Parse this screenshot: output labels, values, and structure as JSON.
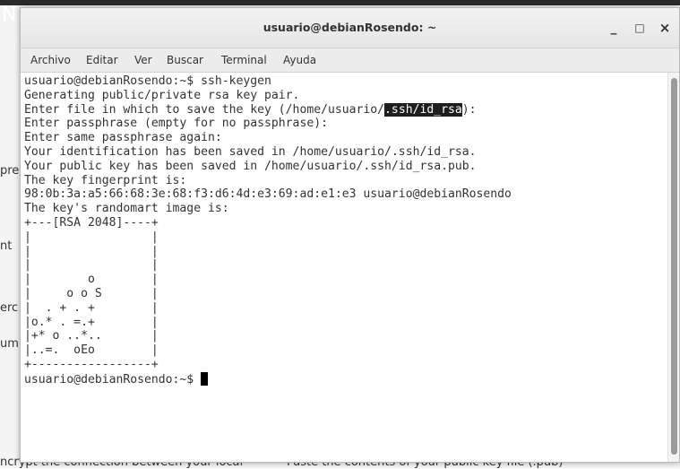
{
  "background": {
    "top_left_glyph": "N",
    "left_fragments": [
      "pre",
      "nt",
      "erc",
      "um"
    ],
    "bottom_left_text": "ncrypt the connection between your local",
    "bottom_right_text": "Paste the contents of your public key file (.pub)"
  },
  "window": {
    "title": "usuario@debianRosendo: ~",
    "minimize_glyph": "_",
    "maximize_glyph": "□",
    "close_glyph": "×"
  },
  "menu": {
    "items": [
      "Archivo",
      "Editar",
      "Ver",
      "Buscar",
      "Terminal",
      "Ayuda"
    ]
  },
  "terminal": {
    "line1": "usuario@debianRosendo:~$ ssh-keygen",
    "line2": "Generating public/private rsa key pair.",
    "line3_prefix": "Enter file in which to save the key (/home/usuario/",
    "line3_selected": ".ssh/id_rsa",
    "line3_suffix": "):",
    "line4": "Enter passphrase (empty for no passphrase):",
    "line5": "Enter same passphrase again:",
    "line6": "Your identification has been saved in /home/usuario/.ssh/id_rsa.",
    "line7": "Your public key has been saved in /home/usuario/.ssh/id_rsa.pub.",
    "line8": "The key fingerprint is:",
    "line9": "98:0b:3a:a5:66:68:3e:68:f3:d6:4d:e3:69:ad:e1:e3 usuario@debianRosendo",
    "line10": "The key's randomart image is:",
    "randomart": "+---[RSA 2048]----+\n|                 |\n|                 |\n|                 |\n|        o        |\n|     o o S       |\n|  . + . +        |\n|o.* . =.+        |\n|+* o ..*..       |\n|..=.  oEo        |\n+-----------------+",
    "prompt": "usuario@debianRosendo:~$ "
  },
  "colors": {
    "selection_bg": "#1e1e1e",
    "selection_fg": "#ffffff",
    "terminal_fg": "#2e3436",
    "terminal_bg": "#ffffff"
  }
}
